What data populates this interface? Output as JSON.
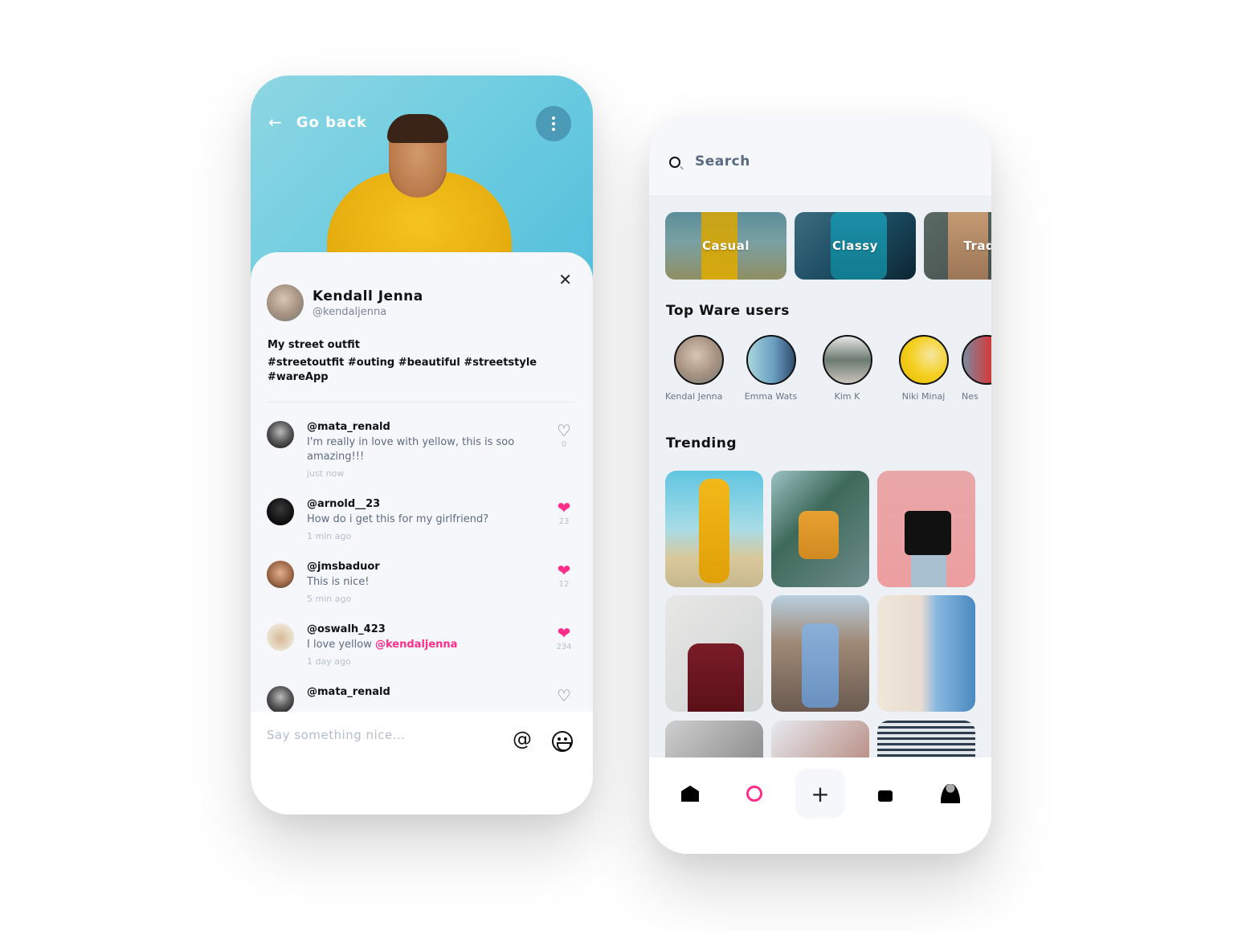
{
  "post_screen": {
    "back_label": "Go back",
    "back_icon": "arrow-left-icon",
    "more_icon": "more-vertical-icon",
    "close_icon": "close-icon",
    "author": {
      "name": "Kendall Jenna",
      "handle": "@kendaljenna"
    },
    "caption": {
      "title": "My street outfit",
      "tags": "#streetoutfit #outing #beautiful #streetstyle #wareApp"
    },
    "comments": [
      {
        "user": "@mata_renald",
        "text": "I'm really in love with yellow, this is soo amazing!!!",
        "mention": "",
        "time": "just now",
        "likes": "0",
        "liked": false
      },
      {
        "user": "@arnold__23",
        "text": "How do i get this for my girlfriend?",
        "mention": "",
        "time": "1 min ago",
        "likes": "23",
        "liked": true
      },
      {
        "user": "@jmsbaduor",
        "text": "This is nice!",
        "mention": "",
        "time": "5 min ago",
        "likes": "12",
        "liked": true
      },
      {
        "user": "@oswalh_423",
        "text": "I love yellow ",
        "mention": "@kendaljenna",
        "time": "1 day ago",
        "likes": "234",
        "liked": true
      },
      {
        "user": "@mata_renald",
        "text": "",
        "mention": "",
        "time": "",
        "likes": "",
        "liked": false
      }
    ],
    "composer": {
      "placeholder": "Say something nice...",
      "mention_icon": "at-icon",
      "emoji_icon": "smiley-icon"
    }
  },
  "search_screen": {
    "search": {
      "placeholder": "Search",
      "icon": "search-icon"
    },
    "categories": [
      {
        "label": "Casual"
      },
      {
        "label": "Classy"
      },
      {
        "label": "Tradit"
      }
    ],
    "top_users_title": "Top Ware users",
    "top_users": [
      {
        "name": "Kendal Jenna"
      },
      {
        "name": "Emma Wats"
      },
      {
        "name": "Kim K"
      },
      {
        "name": "Niki Minaj"
      },
      {
        "name": "Nes"
      }
    ],
    "trending_title": "Trending",
    "bottom_nav": [
      {
        "icon": "home-icon"
      },
      {
        "icon": "search-icon",
        "active": true
      },
      {
        "icon": "plus-icon",
        "label": "+"
      },
      {
        "icon": "bag-icon"
      },
      {
        "icon": "profile-icon"
      }
    ],
    "accent_color": "#ff2d8a"
  }
}
